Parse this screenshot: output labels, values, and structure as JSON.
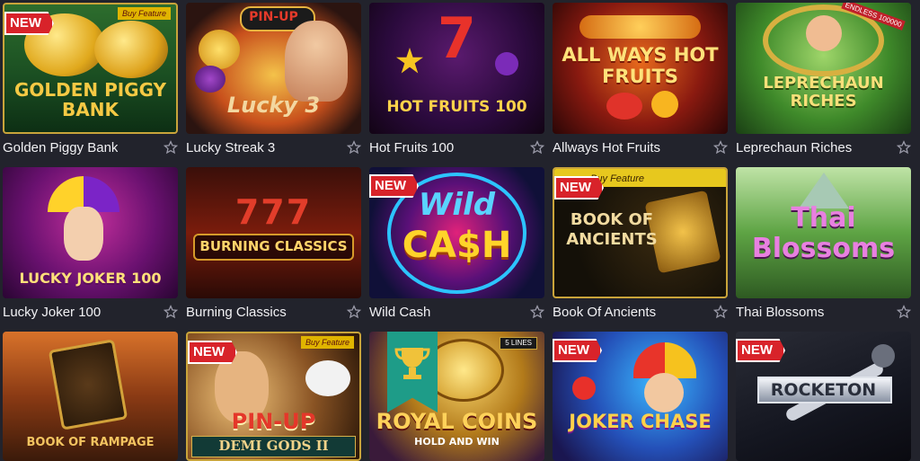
{
  "colors": {
    "background": "#22232c",
    "new_badge": "#d8232a",
    "star_outline": "#9a9aa8"
  },
  "games": [
    {
      "name": "Golden Piggy Bank",
      "art_text": "GOLDEN PIGGY BANK",
      "badge": "NEW",
      "tag": "Buy Feature"
    },
    {
      "name": "Lucky Streak 3",
      "art_text": "Lucky 3",
      "art_sub": "PIN-UP"
    },
    {
      "name": "Hot Fruits 100",
      "art_text": "HOT FRUITS 100"
    },
    {
      "name": "Allways Hot Fruits",
      "art_text": "ALL WAYS HOT FRUITS"
    },
    {
      "name": "Leprechaun Riches",
      "art_text": "LEPRECHAUN RICHES",
      "art_sub": "ENDLESS 100000"
    },
    {
      "name": "Lucky Joker 100",
      "art_text": "LUCKY JOKER 100"
    },
    {
      "name": "Burning Classics",
      "art_text": "BURNING CLASSICS",
      "art_sub": "777"
    },
    {
      "name": "Wild Cash",
      "art_text": "CA$H",
      "art_sub": "Wild",
      "badge": "NEW"
    },
    {
      "name": "Book Of Ancients",
      "art_text": "BOOK OF ANCIENTS",
      "badge": "NEW",
      "tag": "Buy Feature"
    },
    {
      "name": "Thai Blossoms",
      "art_text": "Thai Blossoms"
    },
    {
      "name": "Book of Rampage",
      "art_text": "BOOK OF RAMPAGE"
    },
    {
      "name": "Demi Gods II",
      "art_text": "DEMI GODS II",
      "art_sub": "PIN-UP",
      "badge": "NEW",
      "tag": "Buy Feature"
    },
    {
      "name": "Royal Coins",
      "art_text": "ROYAL COINS",
      "art_sub": "HOLD AND WIN",
      "tag": "5 LINES"
    },
    {
      "name": "Joker Chase",
      "art_text": "JOKER CHASE",
      "badge": "NEW"
    },
    {
      "name": "Rocketon",
      "art_text": "ROCKETON",
      "badge": "NEW"
    }
  ]
}
